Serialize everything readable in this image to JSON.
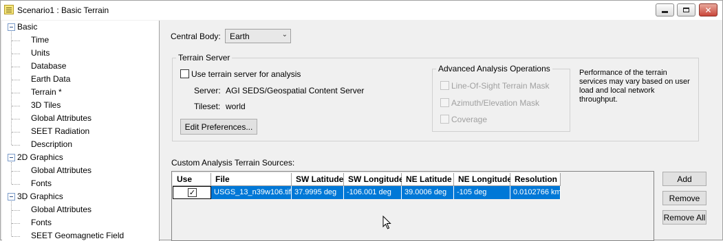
{
  "window": {
    "title": "Scenario1 : Basic Terrain",
    "controls": {
      "minimize_icon": "minimize-icon",
      "maximize_icon": "maximize-icon",
      "close_icon": "close-icon"
    }
  },
  "tree": {
    "groups": [
      {
        "label": "Basic",
        "items": [
          "Time",
          "Units",
          "Database",
          "Earth Data",
          "Terrain *",
          "3D Tiles",
          "Global Attributes",
          "SEET Radiation",
          "Description"
        ]
      },
      {
        "label": "2D Graphics",
        "items": [
          "Global Attributes",
          "Fonts"
        ]
      },
      {
        "label": "3D Graphics",
        "items": [
          "Global Attributes",
          "Fonts",
          "SEET Geomagnetic Field"
        ]
      }
    ],
    "selected": "Terrain *"
  },
  "central_body": {
    "label": "Central Body:",
    "value": "Earth"
  },
  "terrain_server": {
    "group_title": "Terrain Server",
    "use_server_label": "Use terrain server for analysis",
    "use_server_checked": false,
    "server_label": "Server:",
    "server_value": "AGI SEDS/Geospatial Content Server",
    "tileset_label": "Tileset:",
    "tileset_value": "world",
    "edit_prefs_label": "Edit Preferences...",
    "advanced": {
      "title": "Advanced Analysis Operations",
      "options": [
        "Line-Of-Sight Terrain Mask",
        "Azimuth/Elevation Mask",
        "Coverage"
      ]
    },
    "note": [
      "Performance of the terrain",
      "services may vary based on user",
      "load and local network",
      "throughput."
    ]
  },
  "custom_sources": {
    "label": "Custom Analysis Terrain Sources:",
    "columns": [
      "Use",
      "File",
      "SW Latitude",
      "SW Longitude",
      "NE Latitude",
      "NE Longitude",
      "Resolution"
    ],
    "rows": [
      {
        "use": true,
        "cells": [
          "USGS_13_n39w106.tif",
          "37.9995 deg",
          "-106.001 deg",
          "39.0006 deg",
          "-105 deg",
          "0.0102766 km"
        ]
      }
    ],
    "buttons": {
      "add": "Add",
      "remove": "Remove",
      "remove_all": "Remove All"
    }
  },
  "colors": {
    "selection": "#0078d7",
    "window_bg": "#f0f0f0"
  }
}
